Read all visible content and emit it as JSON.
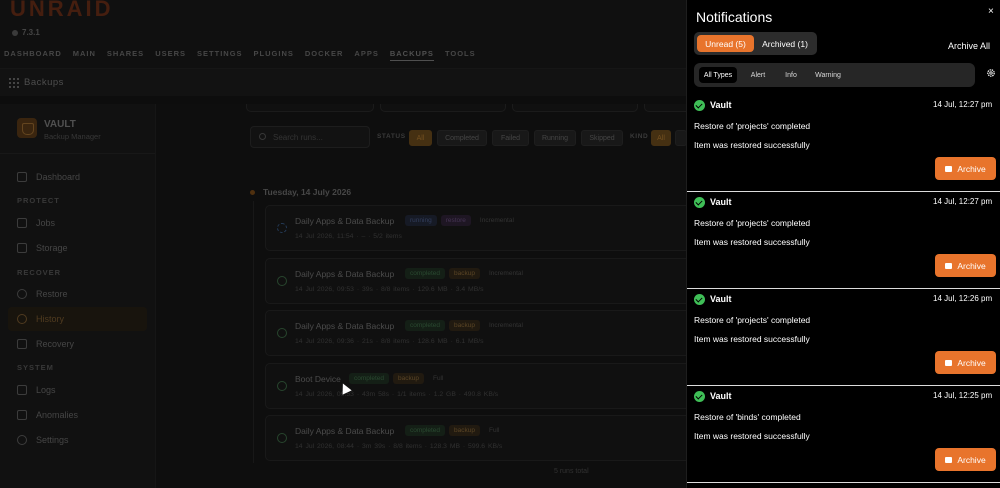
{
  "header": {
    "logo": "UNRAID",
    "version": "7.3.1",
    "nav": [
      "DASHBOARD",
      "MAIN",
      "SHARES",
      "USERS",
      "SETTINGS",
      "PLUGINS",
      "DOCKER",
      "APPS",
      "BACKUPS",
      "TOOLS"
    ],
    "active_nav": "BACKUPS"
  },
  "page_title": "Backups",
  "sidebar": {
    "app_name": "VAULT",
    "app_subtitle": "Backup Manager",
    "dashboard": "Dashboard",
    "protect_label": "PROTECT",
    "jobs": "Jobs",
    "storage": "Storage",
    "recover_label": "RECOVER",
    "restore": "Restore",
    "history": "History",
    "recovery": "Recovery",
    "system_label": "SYSTEM",
    "logs": "Logs",
    "anomalies": "Anomalies",
    "settings": "Settings"
  },
  "filters": {
    "search_placeholder": "Search runs...",
    "status_label": "STATUS",
    "status_options": [
      "All",
      "Completed",
      "Failed",
      "Running",
      "Skipped"
    ],
    "kind_label": "KIND",
    "kind_options": [
      "All"
    ]
  },
  "timeline": {
    "date": "Tuesday, 14 July 2026",
    "runs": [
      {
        "name": "Daily Apps & Data Backup",
        "status": "running",
        "kind": "restore",
        "mode": "Incremental",
        "meta": "14 Jul 2026, 11:54 · – · 5/2 items"
      },
      {
        "name": "Daily Apps & Data Backup",
        "status": "completed",
        "kind": "backup",
        "mode": "Incremental",
        "meta": "14 Jul 2026, 09:53 · 39s · 8/8 items · 129.6 MB · 3.4 MB/s"
      },
      {
        "name": "Daily Apps & Data Backup",
        "status": "completed",
        "kind": "backup",
        "mode": "Incremental",
        "meta": "14 Jul 2026, 09:36 · 21s · 8/8 items · 128.6 MB · 6.1 MB/s"
      },
      {
        "name": "Boot Device",
        "status": "completed",
        "kind": "backup",
        "mode": "Full",
        "meta": "14 Jul 2026, 09:53 · 43m 58s · 1/1 items · 1.2 GB · 490.8 KB/s"
      },
      {
        "name": "Daily Apps & Data Backup",
        "status": "completed",
        "kind": "backup",
        "mode": "Full",
        "meta": "14 Jul 2026, 08:44 · 3m 39s · 8/8 items · 128.3 MB · 599.6 KB/s"
      }
    ],
    "total": "5 runs total"
  },
  "notifications": {
    "title": "Notifications",
    "close": "×",
    "tab_unread": "Unread (5)",
    "tab_archived": "Archived (1)",
    "archive_all": "Archive All",
    "types": [
      "All Types",
      "Alert",
      "Info",
      "Warning"
    ],
    "items": [
      {
        "source": "Vault",
        "time": "14 Jul, 12:27 pm",
        "subject": "Restore of 'projects' completed",
        "description": "Item was restored successfully",
        "action": "Archive"
      },
      {
        "source": "Vault",
        "time": "14 Jul, 12:27 pm",
        "subject": "Restore of 'projects' completed",
        "description": "Item was restored successfully",
        "action": "Archive"
      },
      {
        "source": "Vault",
        "time": "14 Jul, 12:26 pm",
        "subject": "Restore of 'projects' completed",
        "description": "Item was restored successfully",
        "action": "Archive"
      },
      {
        "source": "Vault",
        "time": "14 Jul, 12:25 pm",
        "subject": "Restore of 'binds' completed",
        "description": "Item was restored successfully",
        "action": "Archive"
      }
    ]
  },
  "colors": {
    "accent": "#e8742c",
    "success": "#3fbf57"
  }
}
